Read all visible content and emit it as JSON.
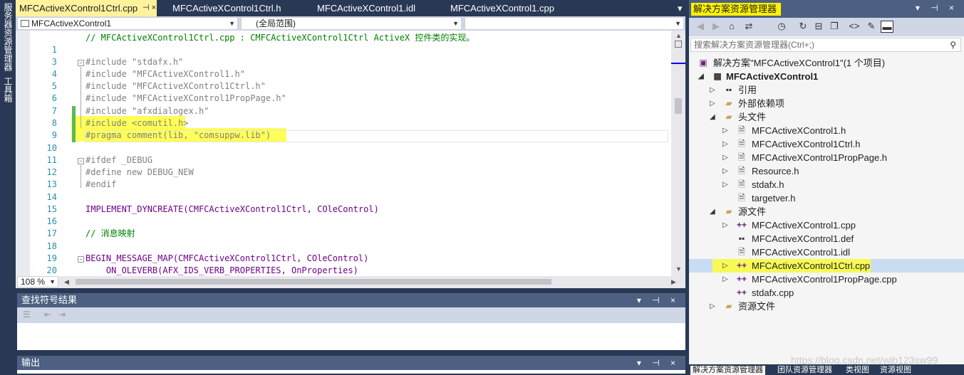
{
  "left_dock": {
    "tabs": [
      "服务器资源管理器",
      "工具箱"
    ]
  },
  "editor": {
    "tabs": [
      {
        "label": "MFCActiveXControl1Ctrl.cpp",
        "pin": "⊣ ×"
      },
      {
        "label": "MFCActiveXControl1Ctrl.h"
      },
      {
        "label": "MFCActiveXControl1.idl"
      },
      {
        "label": "MFCActiveXControl1.cpp"
      }
    ],
    "tab_dropdown": "▾",
    "nav": {
      "project": "MFCActiveXControl1",
      "scope": "(全局范围)",
      "member": ""
    },
    "zoom": "108 %",
    "lines": [
      {
        "num": "",
        "text": "// MFCActiveXControl1Ctrl.cpp : CMFCActiveXControl1Ctrl ActiveX 控件类的实现。"
      },
      {
        "num": "1",
        "text": ""
      },
      {
        "num": "3",
        "text": "#include \"stdafx.h\""
      },
      {
        "num": "4",
        "text": "#include \"MFCActiveXControl1.h\""
      },
      {
        "num": "5",
        "text": "#include \"MFCActiveXControl1Ctrl.h\""
      },
      {
        "num": "6",
        "text": "#include \"MFCActiveXControl1PropPage.h\""
      },
      {
        "num": "7",
        "text": "#include \"afxdialogex.h\""
      },
      {
        "num": "8",
        "text": "#include <comutil.h>"
      },
      {
        "num": "9",
        "text": "#pragma comment(lib, \"comsuppw.lib\")"
      },
      {
        "num": "10",
        "text": ""
      },
      {
        "num": "11",
        "text": "#ifdef _DEBUG"
      },
      {
        "num": "12",
        "text": "#define new DEBUG_NEW"
      },
      {
        "num": "13",
        "text": "#endif"
      },
      {
        "num": "14",
        "text": ""
      },
      {
        "num": "15",
        "text": "IMPLEMENT_DYNCREATE(CMFCActiveXControl1Ctrl, COleControl)"
      },
      {
        "num": "16",
        "text": ""
      },
      {
        "num": "17",
        "text": "// 消息映射"
      },
      {
        "num": "18",
        "text": ""
      },
      {
        "num": "19",
        "text": "BEGIN_MESSAGE_MAP(CMFCActiveXControl1Ctrl, COleControl)"
      },
      {
        "num": "20",
        "text": "    ON_OLEVERB(AFX_IDS_VERB_PROPERTIES, OnProperties)"
      }
    ]
  },
  "find_symbol": {
    "title": "查找符号结果",
    "controls": "▾ ⊣ ×"
  },
  "output": {
    "title": "输出",
    "controls": "▾ ⊣ ×"
  },
  "solution_explorer": {
    "title": "解决方案资源管理器",
    "controls": "▾ ⊣ ×",
    "search_placeholder": "搜索解决方案资源管理器(Ctrl+;)",
    "items": [
      {
        "label": "解决方案\"MFCActiveXControl1\"(1 个项目)",
        "icon": "solution-icon"
      },
      {
        "label": "MFCActiveXControl1",
        "icon": "project-icon"
      },
      {
        "label": "引用",
        "icon": "references-icon"
      },
      {
        "label": "外部依赖项",
        "icon": "dependencies-icon"
      },
      {
        "label": "头文件",
        "icon": "folder-icon"
      },
      {
        "label": "MFCActiveXControl1.h",
        "icon": "header-file-icon"
      },
      {
        "label": "MFCActiveXControl1Ctrl.h",
        "icon": "header-file-icon"
      },
      {
        "label": "MFCActiveXControl1PropPage.h",
        "icon": "header-file-icon"
      },
      {
        "label": "Resource.h",
        "icon": "header-file-icon"
      },
      {
        "label": "stdafx.h",
        "icon": "header-file-icon"
      },
      {
        "label": "targetver.h",
        "icon": "header-file-icon"
      },
      {
        "label": "源文件",
        "icon": "folder-icon"
      },
      {
        "label": "MFCActiveXControl1.cpp",
        "icon": "cpp-file-icon"
      },
      {
        "label": "MFCActiveXControl1.def",
        "icon": "def-file-icon"
      },
      {
        "label": "MFCActiveXControl1.idl",
        "icon": "idl-file-icon"
      },
      {
        "label": "MFCActiveXControl1Ctrl.cpp",
        "icon": "cpp-file-icon"
      },
      {
        "label": "MFCActiveXControl1PropPage.cpp",
        "icon": "cpp-file-icon"
      },
      {
        "label": "stdafx.cpp",
        "icon": "cpp-file-icon"
      },
      {
        "label": "资源文件",
        "icon": "folder-icon"
      }
    ],
    "bottom_tabs": [
      "解决方案资源管理器",
      "团队资源管理器",
      "类视图",
      "资源视图"
    ]
  },
  "watermark": "https://blog.csdn.net/wjb123sw99",
  "colors": {
    "highlight": "#ffff3a",
    "panel_header": "#4d6082",
    "background": "#293955",
    "line_numbers": "#2b91af",
    "keyword": "#0000ff",
    "string": "#a31515",
    "comment": "#008000"
  }
}
